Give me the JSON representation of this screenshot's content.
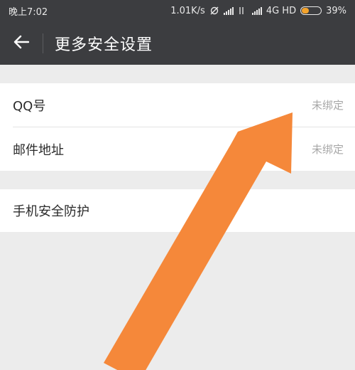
{
  "status_bar": {
    "time": "晚上7:02",
    "speed": "1.01K/s",
    "network": "4G HD",
    "battery": "39%",
    "battery_level": 0.39,
    "battery_color": "#f3a32c"
  },
  "header": {
    "back_icon": "arrow-left-icon",
    "title": "更多安全设置"
  },
  "settings": {
    "groups": [
      {
        "items": [
          {
            "label": "QQ号",
            "value": "未绑定"
          },
          {
            "label": "邮件地址",
            "value": "未绑定"
          }
        ]
      },
      {
        "items": [
          {
            "label": "手机安全防护"
          }
        ]
      }
    ]
  },
  "annotation": {
    "arrow_color": "#f5883a"
  }
}
